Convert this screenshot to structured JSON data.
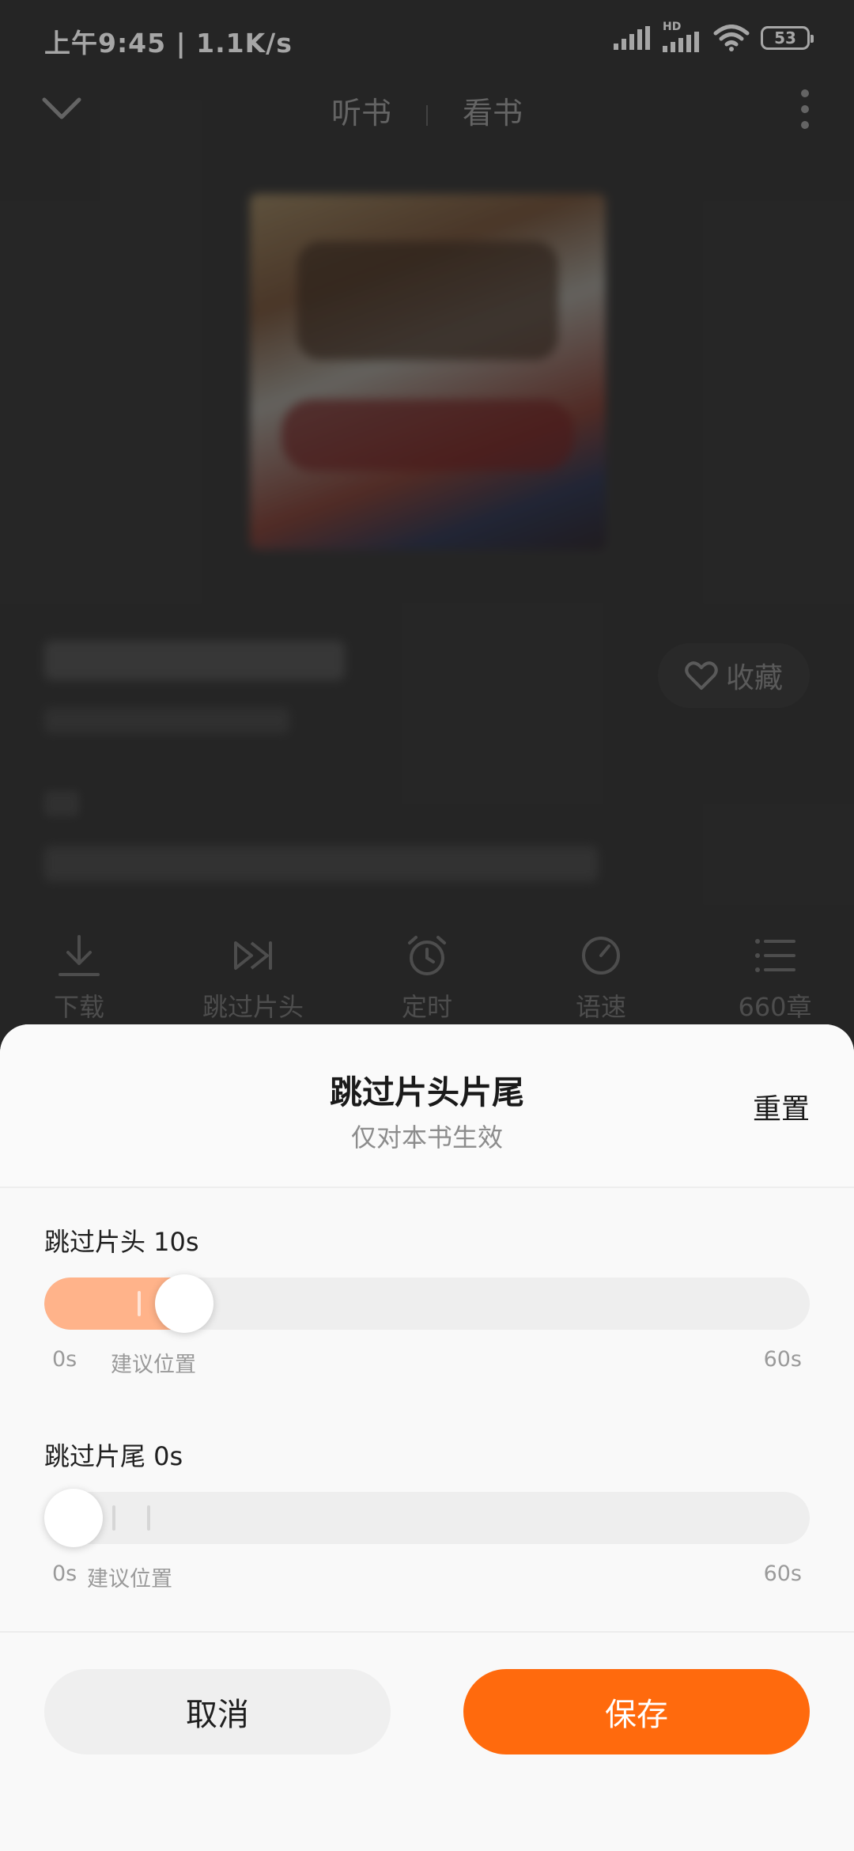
{
  "status_bar": {
    "time": "上午9:45 | 1.1K/s",
    "battery": "53",
    "signal_label": "HD"
  },
  "nav": {
    "tabs": [
      "听书",
      "看书"
    ]
  },
  "player": {
    "favorite_label": "收藏",
    "toolbar": [
      {
        "label": "下载",
        "icon": "download-icon"
      },
      {
        "label": "跳过片头",
        "icon": "skip-icon"
      },
      {
        "label": "定时",
        "icon": "alarm-icon"
      },
      {
        "label": "语速",
        "icon": "speed-icon"
      },
      {
        "label": "660章",
        "icon": "list-icon"
      }
    ]
  },
  "sheet": {
    "title": "跳过片头片尾",
    "subtitle": "仅对本书生效",
    "reset_label": "重置",
    "intro": {
      "label": "跳过片头 10s",
      "value": 10,
      "max": 60,
      "min_label": "0s",
      "max_label": "60s",
      "hint_label": "建议位置"
    },
    "outro": {
      "label": "跳过片尾 0s",
      "value": 0,
      "max": 60,
      "min_label": "0s",
      "max_label": "60s",
      "hint_label": "建议位置"
    },
    "cancel_label": "取消",
    "save_label": "保存"
  },
  "colors": {
    "accent": "#ff6a0d",
    "slider_fill": "#ffb38a"
  }
}
